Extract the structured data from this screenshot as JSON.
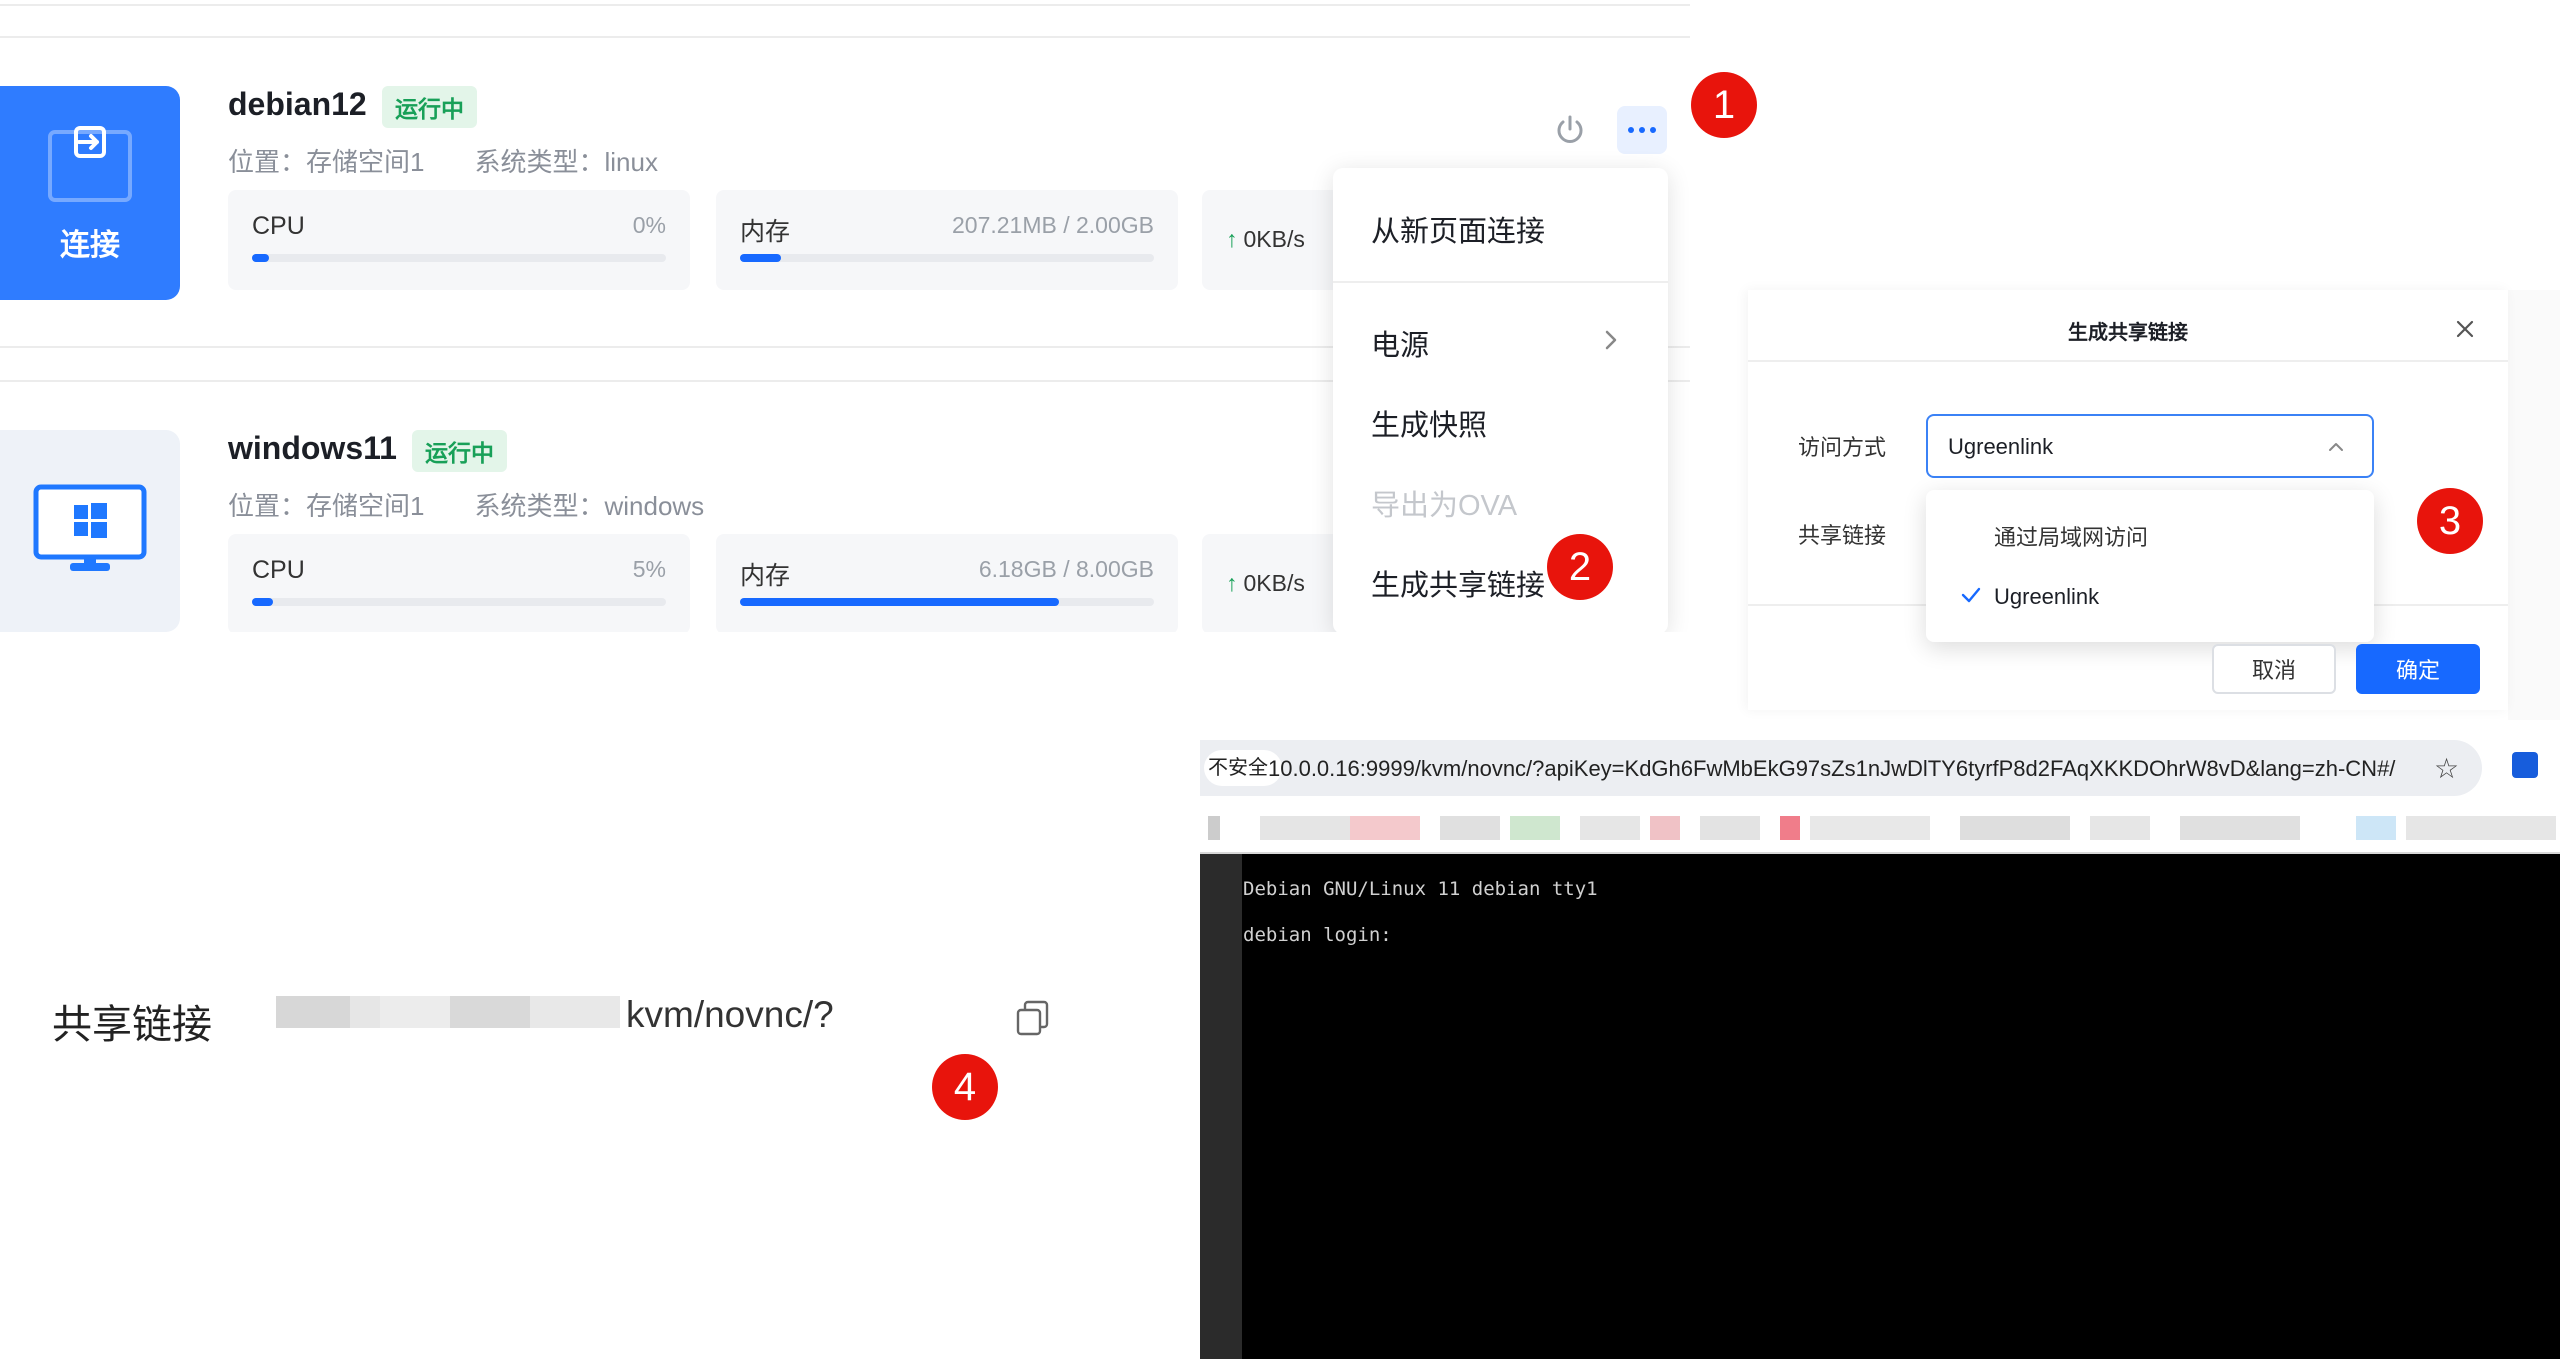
{
  "vms": [
    {
      "name": "debian12",
      "status": "运行中",
      "location": "位置：存储空间1",
      "system": "系统类型：linux",
      "cpu_label": "CPU",
      "cpu_value": "0%",
      "cpu_usage": 0,
      "mem_label": "内存",
      "mem_value": "207.21MB / 2.00GB",
      "mem_usage": 0.1,
      "net": "0KB/s",
      "connect_label": "连接"
    },
    {
      "name": "windows11",
      "status": "运行中",
      "location": "位置：存储空间1",
      "system": "系统类型：windows",
      "cpu_label": "CPU",
      "cpu_value": "5%",
      "cpu_usage": 0.05,
      "mem_label": "内存",
      "mem_value": "6.18GB / 8.00GB",
      "mem_usage": 0.77,
      "net": "0KB/s"
    }
  ],
  "menu": {
    "items": [
      {
        "label": "从新页面连接",
        "disabled": false
      },
      {
        "label": "电源",
        "disabled": false,
        "has_submenu": true
      },
      {
        "label": "生成快照",
        "disabled": false
      },
      {
        "label": "导出为OVA",
        "disabled": true
      },
      {
        "label": "生成共享链接",
        "disabled": false
      }
    ]
  },
  "markers": [
    "1",
    "2",
    "3",
    "4"
  ],
  "dialog": {
    "title": "生成共享链接",
    "access_label": "访问方式",
    "share_label": "共享链接",
    "select_value": "Ugreenlink",
    "options": [
      {
        "label": "通过局域网访问",
        "selected": false
      },
      {
        "label": "Ugreenlink",
        "selected": true
      }
    ],
    "cancel": "取消",
    "confirm": "确定"
  },
  "browser": {
    "security_label": "不安全",
    "url": "10.0.0.16:9999/kvm/novnc/?apiKey=KdGh6FwMbEkG97sZs1nJwDlTY6tyrfP8d2FAqXKKDOhrW8vD&lang=zh-CN#/",
    "console_lines": [
      "Debian GNU/Linux 11 debian tty1",
      "debian login:"
    ]
  },
  "share_row": {
    "label": "共享链接",
    "url_suffix": "kvm/novnc/?"
  },
  "colors": {
    "accent": "#1769ff",
    "status_green": "#18a058",
    "marker_red": "#e8140c"
  },
  "icons": [
    "connect-icon",
    "monitor-windows-icon",
    "power-icon",
    "more-icon",
    "chevron-right-icon",
    "close-icon",
    "chevron-up-icon",
    "check-icon",
    "star-icon",
    "bitwarden-icon",
    "copy-icon",
    "arrow-up-icon"
  ]
}
